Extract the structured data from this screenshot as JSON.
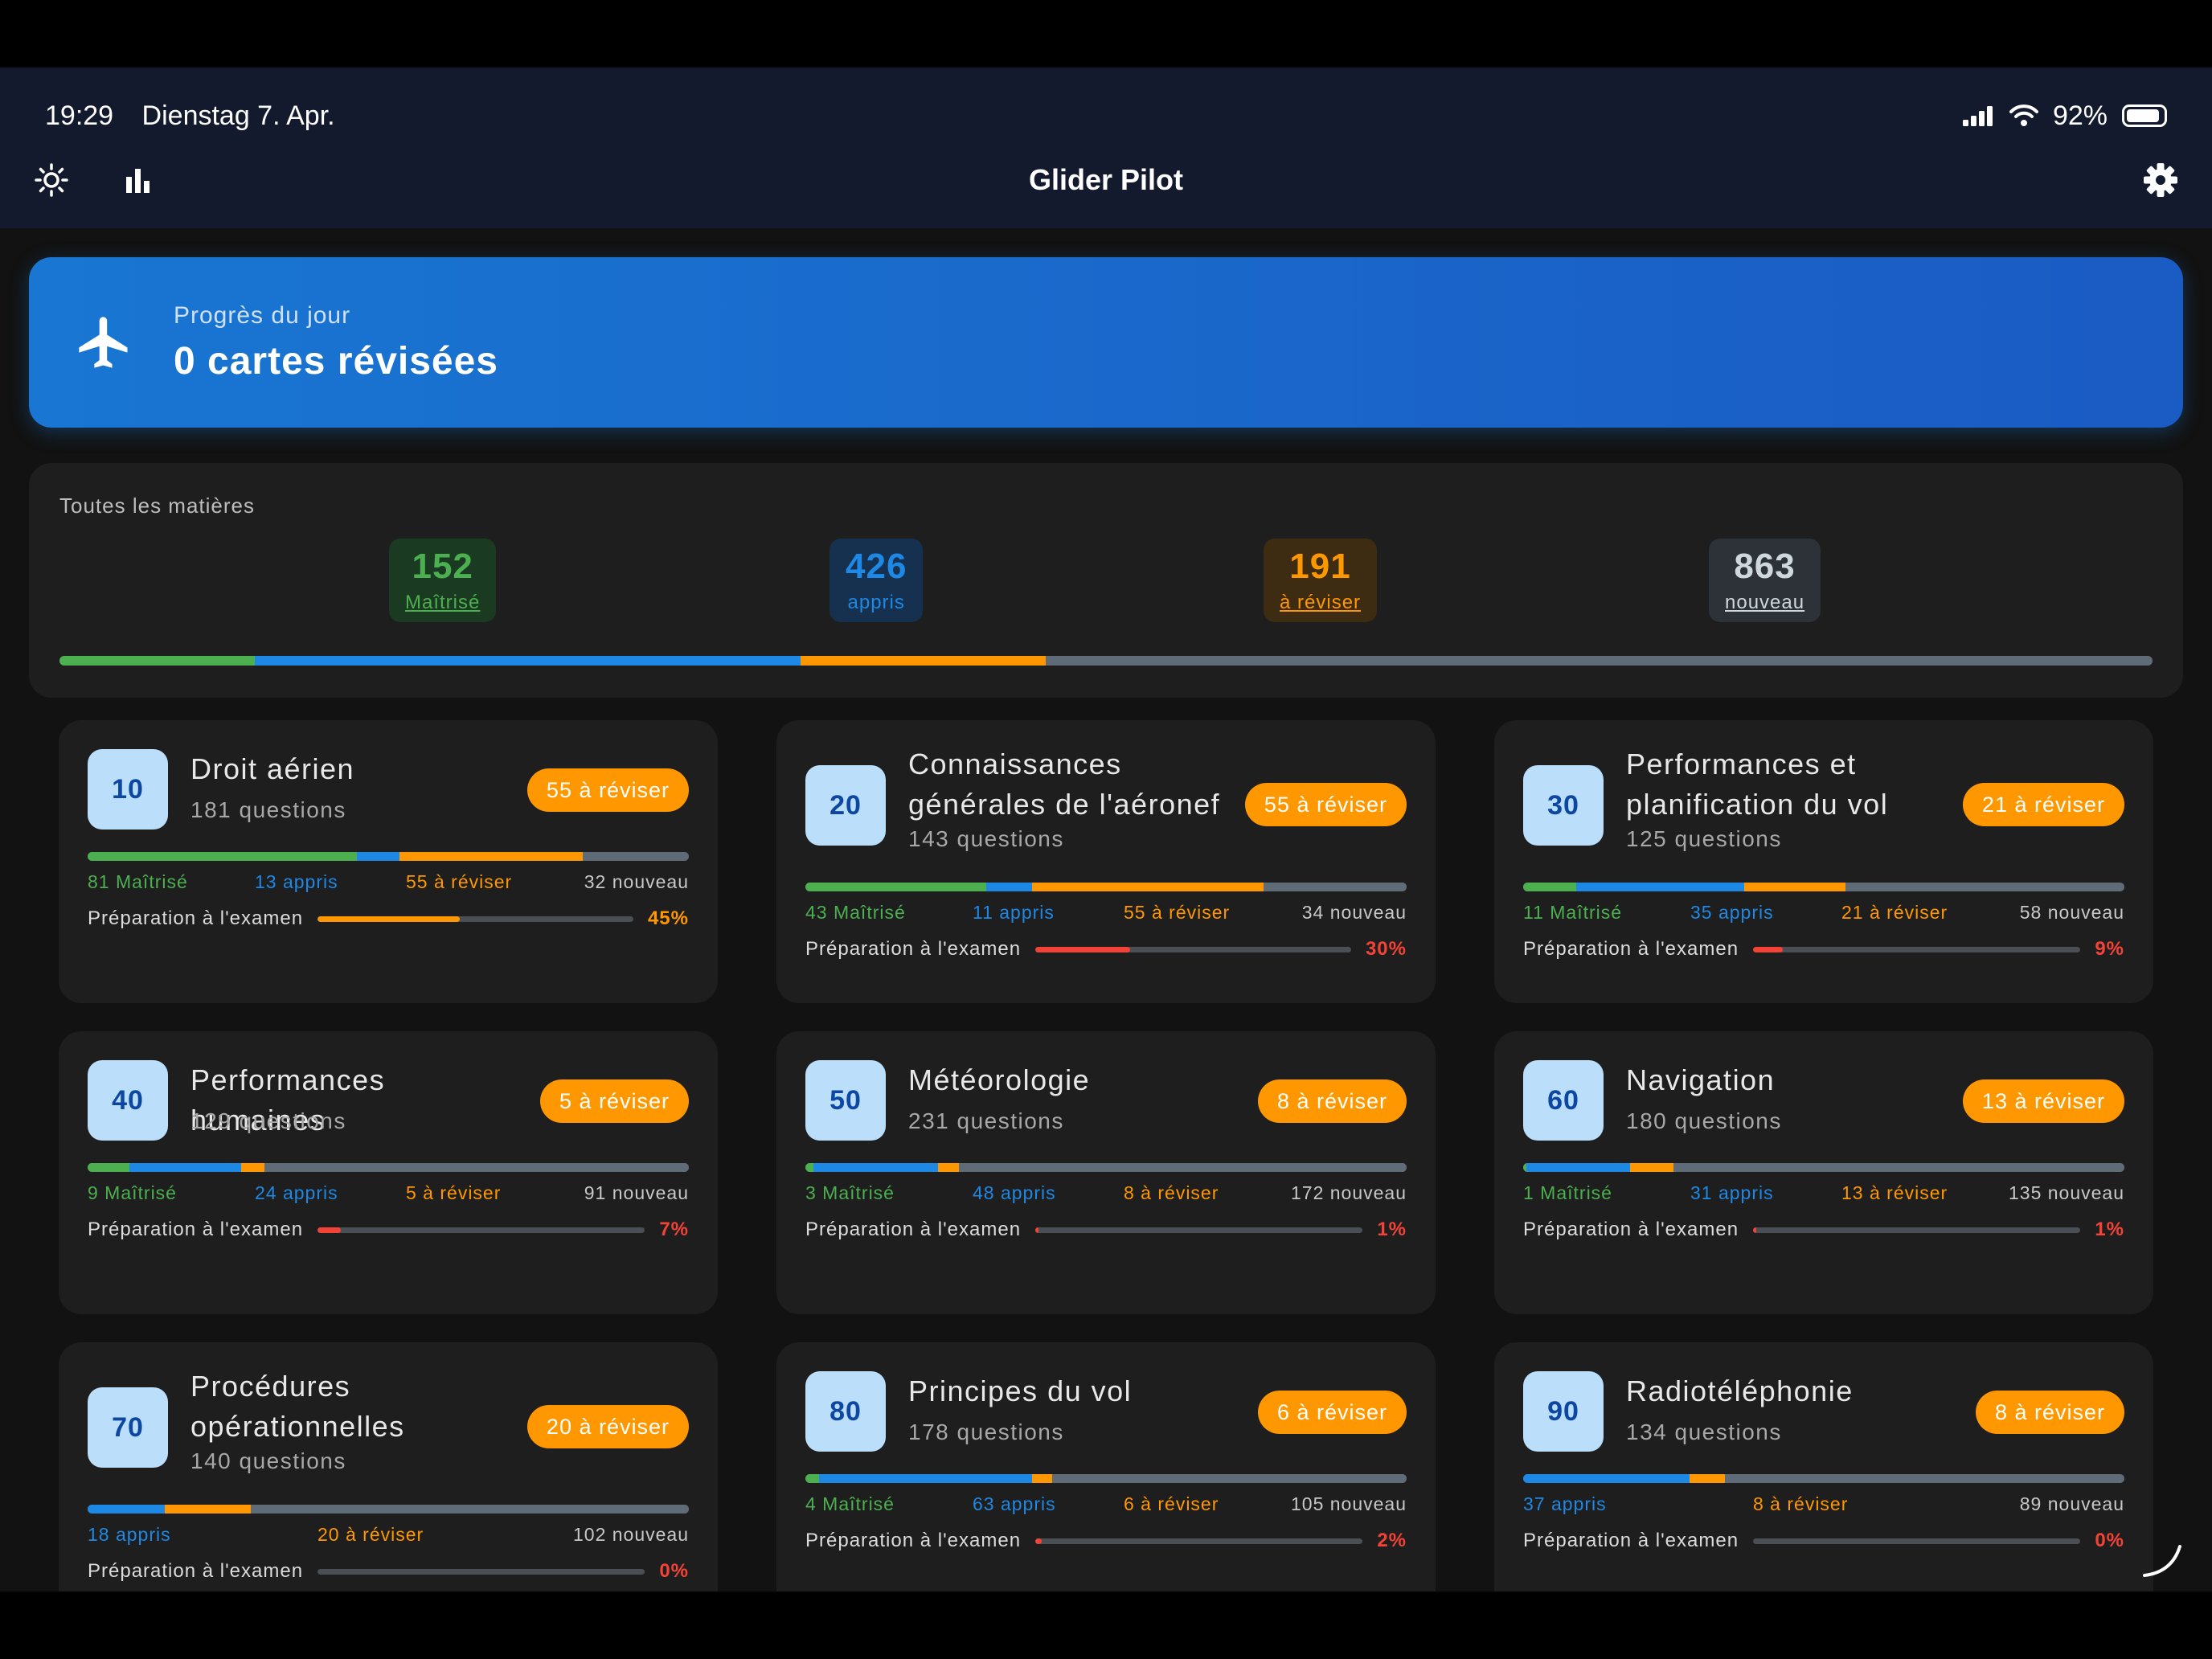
{
  "status_bar": {
    "time": "19:29",
    "date": "Dienstag 7. Apr.",
    "battery_text": "92%",
    "battery_level": 0.92
  },
  "nav": {
    "title": "Glider Pilot"
  },
  "today": {
    "label": "Progrès du jour",
    "value": "0 cartes révisées"
  },
  "all_subjects": {
    "label": "Toutes les matières",
    "stats": [
      {
        "value": "152",
        "label": "Maîtrisé",
        "color": "#4caf50",
        "bg": "#1b3a22"
      },
      {
        "value": "426",
        "label": "appris",
        "color": "#1e88e5",
        "bg": "#15314f"
      },
      {
        "value": "191",
        "label": "à réviser",
        "color": "#ff9800",
        "bg": "#3e2c12"
      },
      {
        "value": "863",
        "label": "nouveau",
        "color": "#cfd8dc",
        "bg": "#2c3238"
      }
    ],
    "bar": [
      152,
      426,
      191,
      863
    ]
  },
  "colors": {
    "mastered": "#4caf50",
    "learned": "#1e88e5",
    "review": "#ff9800",
    "new": "#5f6b76",
    "low": "#f44336",
    "prep_mid": "#ff9800"
  },
  "legend_labels": {
    "mastered": "Maîtrisé",
    "learned": "appris",
    "review": "à réviser",
    "new": "nouveau"
  },
  "prep_label": "Préparation à l'examen",
  "subjects": [
    {
      "code": "10",
      "name": "Droit aérien",
      "count_text": "181 questions",
      "badge": "55 à réviser",
      "mastered": 81,
      "learned": 13,
      "review": 55,
      "new": 32,
      "mastered_text": "81 Maîtrisé",
      "learned_text": "13 appris",
      "review_text": "55 à réviser",
      "new_text": "32 nouveau",
      "prep": 45,
      "prep_text": "45%"
    },
    {
      "code": "20",
      "name": "Connaissances générales de l'aéronef",
      "count_text": "143 questions",
      "badge": "55 à réviser",
      "mastered": 43,
      "learned": 11,
      "review": 55,
      "new": 34,
      "mastered_text": "43 Maîtrisé",
      "learned_text": "11 appris",
      "review_text": "55 à réviser",
      "new_text": "34 nouveau",
      "prep": 30,
      "prep_text": "30%"
    },
    {
      "code": "30",
      "name": "Performances et planification du vol",
      "count_text": "125 questions",
      "badge": "21 à réviser",
      "mastered": 11,
      "learned": 35,
      "review": 21,
      "new": 58,
      "mastered_text": "11 Maîtrisé",
      "learned_text": "35 appris",
      "review_text": "21 à réviser",
      "new_text": "58 nouveau",
      "prep": 9,
      "prep_text": "9%"
    },
    {
      "code": "40",
      "name": "Performances humaines",
      "count_text": "129 questions",
      "badge": "5 à réviser",
      "mastered": 9,
      "learned": 24,
      "review": 5,
      "new": 91,
      "mastered_text": "9 Maîtrisé",
      "learned_text": "24 appris",
      "review_text": "5 à réviser",
      "new_text": "91 nouveau",
      "prep": 7,
      "prep_text": "7%"
    },
    {
      "code": "50",
      "name": "Météorologie",
      "count_text": "231 questions",
      "badge": "8 à réviser",
      "mastered": 3,
      "learned": 48,
      "review": 8,
      "new": 172,
      "mastered_text": "3 Maîtrisé",
      "learned_text": "48 appris",
      "review_text": "8 à réviser",
      "new_text": "172 nouveau",
      "prep": 1,
      "prep_text": "1%"
    },
    {
      "code": "60",
      "name": "Navigation",
      "count_text": "180 questions",
      "badge": "13 à réviser",
      "mastered": 1,
      "learned": 31,
      "review": 13,
      "new": 135,
      "mastered_text": "1 Maîtrisé",
      "learned_text": "31 appris",
      "review_text": "13 à réviser",
      "new_text": "135 nouveau",
      "prep": 1,
      "prep_text": "1%"
    },
    {
      "code": "70",
      "name": "Procédures opérationnelles",
      "count_text": "140 questions",
      "badge": "20 à réviser",
      "mastered": 0,
      "learned": 18,
      "review": 20,
      "new": 102,
      "mastered_text": "",
      "learned_text": "18 appris",
      "review_text": "20 à réviser",
      "new_text": "102 nouveau",
      "prep": 0,
      "prep_text": "0%"
    },
    {
      "code": "80",
      "name": "Principes du vol",
      "count_text": "178 questions",
      "badge": "6 à réviser",
      "mastered": 4,
      "learned": 63,
      "review": 6,
      "new": 105,
      "mastered_text": "4 Maîtrisé",
      "learned_text": "63 appris",
      "review_text": "6 à réviser",
      "new_text": "105 nouveau",
      "prep": 2,
      "prep_text": "2%"
    },
    {
      "code": "90",
      "name": "Radiotéléphonie",
      "count_text": "134 questions",
      "badge": "8 à réviser",
      "mastered": 0,
      "learned": 37,
      "review": 8,
      "new": 89,
      "mastered_text": "",
      "learned_text": "37 appris",
      "review_text": "8 à réviser",
      "new_text": "89 nouveau",
      "prep": 0,
      "prep_text": "0%"
    }
  ]
}
